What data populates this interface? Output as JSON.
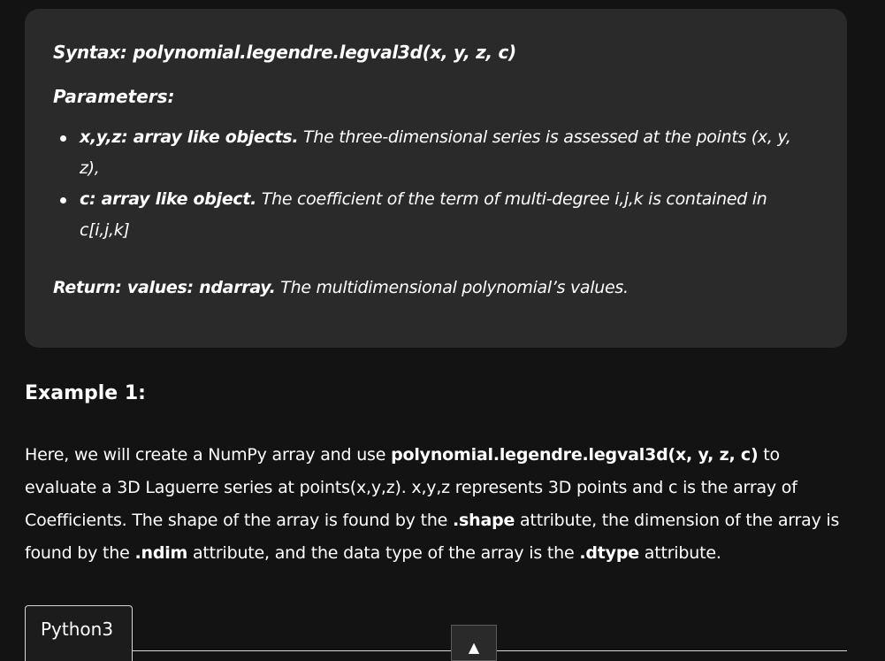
{
  "syntax_box": {
    "syntax": "Syntax: polynomial.legendre.legval3d(x, y, z, c)",
    "parameters_title": "Parameters:",
    "params": [
      {
        "name": "x,y,z: array like objects.",
        "description": " The three-dimensional series is assessed at the points (x, y, z),"
      },
      {
        "name": "c: array like object.",
        "description": " The coefficient of the term of multi-degree i,j,k is contained in c[i,j,k]"
      }
    ],
    "return_label": "Return:  values: ndarray.",
    "return_desc": " The multidimensional polynomial’s values."
  },
  "example": {
    "heading": "Example 1:",
    "para_1": "Here, we will create a NumPy array and use ",
    "code_1": "polynomial.legendre.legval3d(x, y, z, c)",
    "para_2": " to evaluate a 3D Laguerre series at points(x,y,z). x,y,z represents 3D points and c is the array of Coefficients. The shape of the array is found by the ",
    "code_2": ".shape",
    "para_3": " attribute, the dimension of the array is found by the ",
    "code_3": ".ndim",
    "para_4": " attribute, and the data type of the array is the ",
    "code_4": ".dtype",
    "para_5": " attribute."
  },
  "code_tabs": {
    "active_tab": "Python3"
  },
  "scroll_top": {
    "icon": "▲"
  }
}
